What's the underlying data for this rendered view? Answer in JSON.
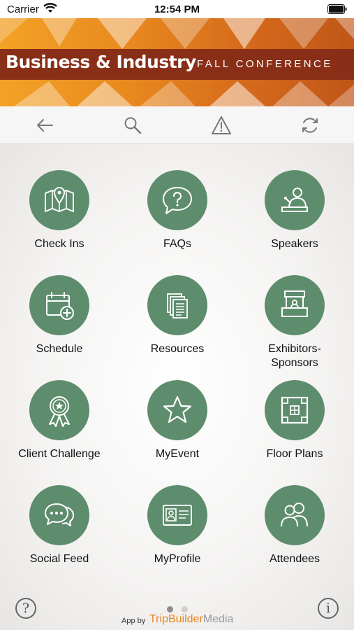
{
  "status_bar": {
    "carrier": "Carrier",
    "time": "12:54 PM"
  },
  "banner": {
    "title": "Business & Industry",
    "subtitle": "FALL CONFERENCE"
  },
  "toolbar": {
    "icons": [
      "back-arrow-icon",
      "search-icon",
      "alert-icon",
      "refresh-icon"
    ]
  },
  "tiles": [
    {
      "label": "Check Ins",
      "icon": "map-pin-icon"
    },
    {
      "label": "FAQs",
      "icon": "question-bubble-icon"
    },
    {
      "label": "Speakers",
      "icon": "speaker-podium-icon"
    },
    {
      "label": "Schedule",
      "icon": "calendar-add-icon"
    },
    {
      "label": "Resources",
      "icon": "documents-icon"
    },
    {
      "label": "Exhibitors-\nSponsors",
      "icon": "booth-icon"
    },
    {
      "label": "Client Challenge",
      "icon": "award-ribbon-icon"
    },
    {
      "label": "MyEvent",
      "icon": "star-icon"
    },
    {
      "label": "Floor Plans",
      "icon": "floor-plan-icon"
    },
    {
      "label": "Social Feed",
      "icon": "chat-bubbles-icon"
    },
    {
      "label": "MyProfile",
      "icon": "id-card-icon"
    },
    {
      "label": "Attendees",
      "icon": "people-icon"
    }
  ],
  "footer": {
    "help_symbol": "?",
    "info_symbol": "i",
    "powered_by": "App by",
    "brand_part1": "TripBuilder",
    "brand_part2": "Media",
    "page_dots": 2,
    "active_page": 1
  },
  "colors": {
    "tile_green": "#5e8d6e",
    "banner_orange": "#e98a1e",
    "banner_strip": "#8a2f17",
    "brand_orange": "#e6861c"
  }
}
